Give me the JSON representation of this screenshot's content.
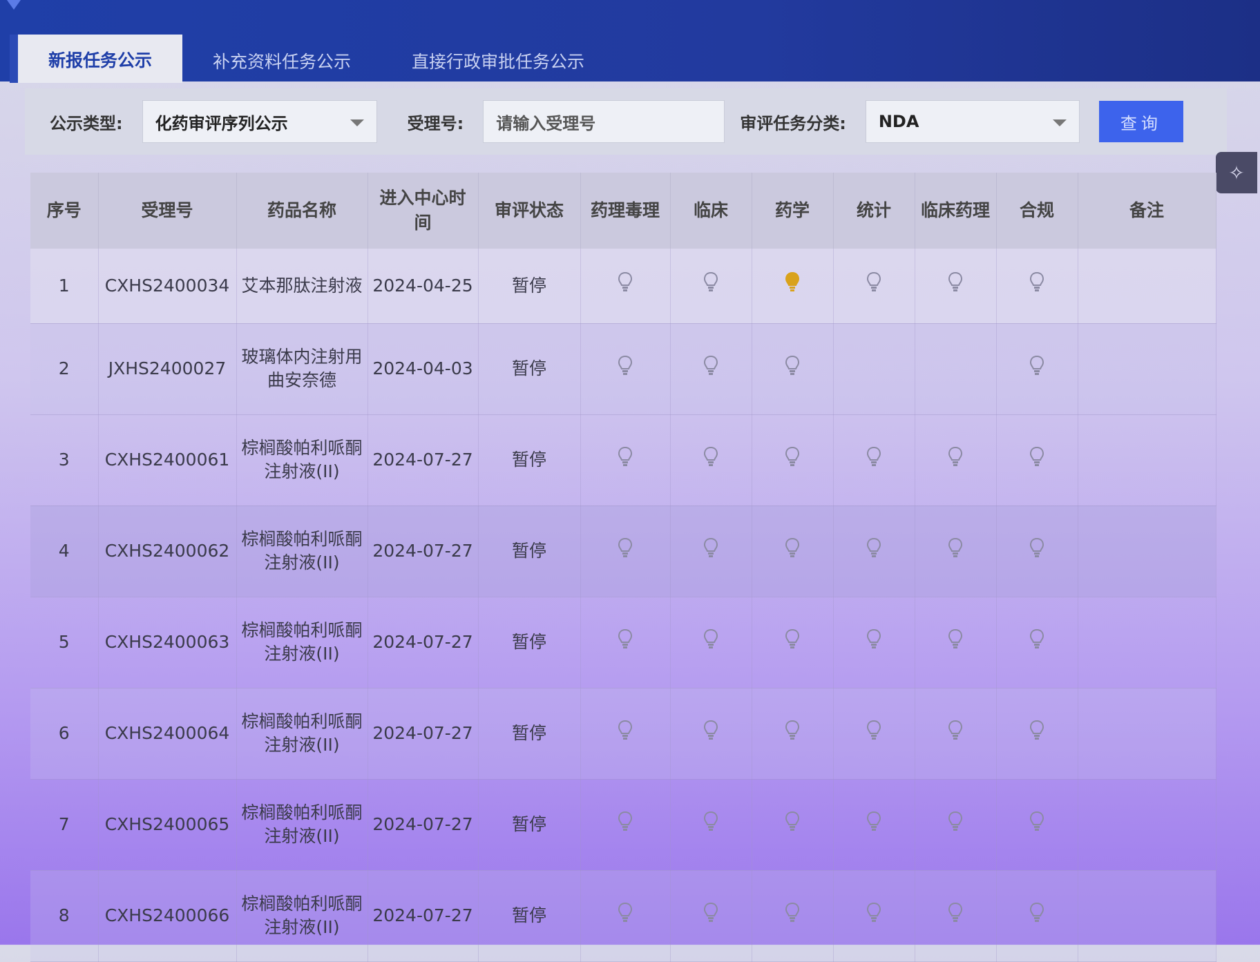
{
  "tabs": [
    "新报任务公示",
    "补充资料任务公示",
    "直接行政审批任务公示"
  ],
  "filter": {
    "type_label": "公示类型:",
    "type_value": "化药审评序列公示",
    "accept_label": "受理号:",
    "accept_placeholder": "请输入受理号",
    "category_label": "审评任务分类:",
    "category_value": "NDA",
    "query_button": "查询"
  },
  "table": {
    "headers": [
      "序号",
      "受理号",
      "药品名称",
      "进入中心时间",
      "审评状态",
      "药理毒理",
      "临床",
      "药学",
      "统计",
      "临床药理",
      "合规",
      "备注"
    ],
    "rows": [
      {
        "no": "1",
        "id": "CXHS2400034",
        "name": "艾本那肽注射液",
        "date": "2024-04-25",
        "status": "暂停",
        "bulbs": [
          "off",
          "off",
          "on",
          "off",
          "off",
          "off"
        ]
      },
      {
        "no": "2",
        "id": "JXHS2400027",
        "name": "玻璃体内注射用曲安奈德",
        "date": "2024-04-03",
        "status": "暂停",
        "bulbs": [
          "off",
          "off",
          "off",
          "none",
          "none",
          "off"
        ]
      },
      {
        "no": "3",
        "id": "CXHS2400061",
        "name": "棕榈酸帕利哌酮注射液(II)",
        "date": "2024-07-27",
        "status": "暂停",
        "bulbs": [
          "off",
          "off",
          "off",
          "off",
          "off",
          "off"
        ]
      },
      {
        "no": "4",
        "id": "CXHS2400062",
        "name": "棕榈酸帕利哌酮注射液(II)",
        "date": "2024-07-27",
        "status": "暂停",
        "bulbs": [
          "off",
          "off",
          "off",
          "off",
          "off",
          "off"
        ]
      },
      {
        "no": "5",
        "id": "CXHS2400063",
        "name": "棕榈酸帕利哌酮注射液(II)",
        "date": "2024-07-27",
        "status": "暂停",
        "bulbs": [
          "off",
          "off",
          "off",
          "off",
          "off",
          "off"
        ]
      },
      {
        "no": "6",
        "id": "CXHS2400064",
        "name": "棕榈酸帕利哌酮注射液(II)",
        "date": "2024-07-27",
        "status": "暂停",
        "bulbs": [
          "off",
          "off",
          "off",
          "off",
          "off",
          "off"
        ]
      },
      {
        "no": "7",
        "id": "CXHS2400065",
        "name": "棕榈酸帕利哌酮注射液(II)",
        "date": "2024-07-27",
        "status": "暂停",
        "bulbs": [
          "off",
          "off",
          "off",
          "off",
          "off",
          "off"
        ]
      },
      {
        "no": "8",
        "id": "CXHS2400066",
        "name": "棕榈酸帕利哌酮注射液(II)",
        "date": "2024-07-27",
        "status": "暂停",
        "bulbs": [
          "off",
          "off",
          "off",
          "off",
          "off",
          "off"
        ]
      }
    ]
  },
  "colors": {
    "bulb_on": "#d9a21b",
    "bulb_off": "#8b8aa3",
    "accent": "#3d63ec"
  },
  "icons": {
    "side_tool": "magic-wand-icon",
    "cursor": "mouse-pointer-icon",
    "bulb": "lightbulb-icon"
  }
}
